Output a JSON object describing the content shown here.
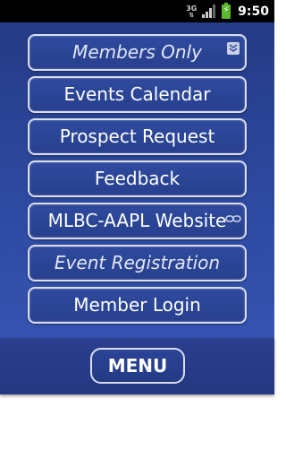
{
  "status_bar": {
    "network_label": "3G",
    "time": "9:50",
    "icons": [
      "network-3g-icon",
      "signal-strength-icon",
      "battery-charging-icon"
    ]
  },
  "menu": {
    "items": [
      {
        "label": "Members Only",
        "italic": true,
        "icon": "chevron-double-down-icon"
      },
      {
        "label": "Events Calendar",
        "italic": false
      },
      {
        "label": "Prospect Request",
        "italic": false
      },
      {
        "label": "Feedback",
        "italic": false
      },
      {
        "label": "MLBC-AAPL Website",
        "italic": false,
        "icon": "link-icon"
      },
      {
        "label": "Event Registration",
        "italic": true
      },
      {
        "label": "Member Login",
        "italic": false
      }
    ]
  },
  "bottom_bar": {
    "menu_button_label": "MENU"
  },
  "colors": {
    "panel_background": "#2e4aa2",
    "button_border": "#d9def0",
    "battery": "#5cb82e"
  }
}
